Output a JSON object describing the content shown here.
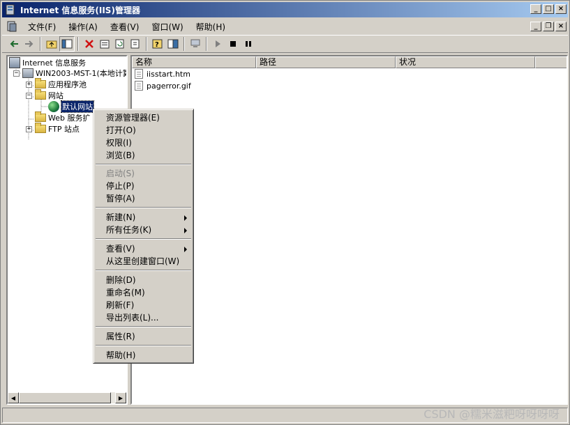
{
  "window": {
    "title": "Internet 信息服务(IIS)管理器"
  },
  "menubar": {
    "items": [
      "文件(F)",
      "操作(A)",
      "查看(V)",
      "窗口(W)",
      "帮助(H)"
    ]
  },
  "tree": {
    "root": "Internet 信息服务",
    "server": "WIN2003-MST-1(本地计算",
    "app_pools": "应用程序池",
    "websites": "网站",
    "default_site": "默认网站",
    "web_ext": "Web 服务扩",
    "ftp_sites": "FTP 站点"
  },
  "list": {
    "columns": [
      "名称",
      "路径",
      "状况"
    ],
    "files": [
      "iisstart.htm",
      "pagerror.gif"
    ]
  },
  "context_menu": {
    "explore": "资源管理器(E)",
    "open": "打开(O)",
    "permissions": "权限(I)",
    "browse": "浏览(B)",
    "start": "启动(S)",
    "stop": "停止(P)",
    "pause": "暂停(A)",
    "new": "新建(N)",
    "all_tasks": "所有任务(K)",
    "view": "查看(V)",
    "new_window": "从这里创建窗口(W)",
    "delete": "删除(D)",
    "rename": "重命名(M)",
    "refresh": "刷新(F)",
    "export": "导出列表(L)...",
    "properties": "属性(R)",
    "help": "帮助(H)"
  },
  "watermark": "CSDN @糯米滋粑呀呀呀呀",
  "colors": {
    "title_start": "#0a246a",
    "title_end": "#a6caf0",
    "selection": "#0a246a",
    "chrome": "#d4d0c8"
  }
}
